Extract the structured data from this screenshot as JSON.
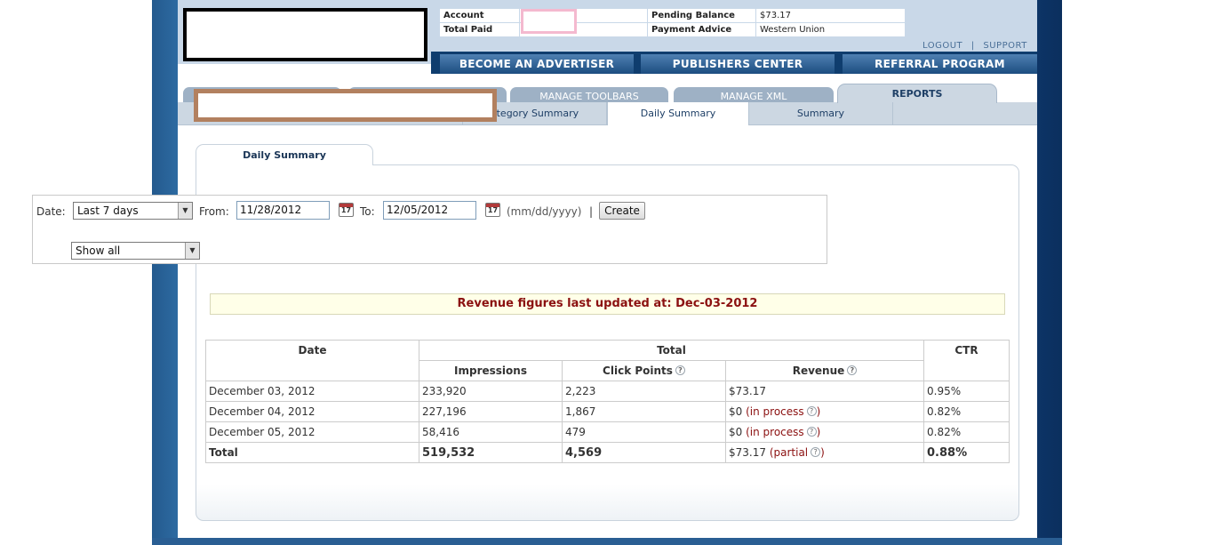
{
  "header": {
    "info": {
      "account_label": "Account",
      "total_paid_label": "Total Paid",
      "pending_balance_label": "Pending Balance",
      "pending_balance_value": "$73.17",
      "payment_advice_label": "Payment Advice",
      "payment_advice_value": "Western Union"
    },
    "links": {
      "logout": "LOGOUT",
      "support": "SUPPORT",
      "separator": "|"
    },
    "nav": [
      "BECOME AN ADVERTISER",
      "PUBLISHERS CENTER",
      "REFERRAL PROGRAM"
    ]
  },
  "tabs": {
    "top": [
      "MANAGE TOOLBARS",
      "MANAGE XML",
      "REPORTS"
    ],
    "sub": [
      "ategory Summary",
      "Daily Summary",
      "Summary"
    ]
  },
  "panel": {
    "title": "Daily Summary",
    "filters": {
      "date_label": "Date:",
      "date_select": "Last 7 days",
      "from_label": "From:",
      "from_value": "11/28/2012",
      "to_label": "To:",
      "to_value": "12/05/2012",
      "format_hint": "(mm/dd/yyyy)",
      "separator": "|",
      "create_button": "Create",
      "show_select": "Show all",
      "calendar_digit": "17"
    },
    "notice": "Revenue figures last updated at: Dec-03-2012"
  },
  "report": {
    "headers": {
      "date": "Date",
      "total": "Total",
      "ctr": "CTR",
      "impressions": "Impressions",
      "click_points": "Click Points",
      "revenue": "Revenue",
      "help_glyph": "?"
    },
    "rows": [
      {
        "date": "December 03, 2012",
        "impressions": "233,920",
        "clicks": "2,223",
        "revenue": "$73.17",
        "status": "",
        "ctr": "0.95%"
      },
      {
        "date": "December 04, 2012",
        "impressions": "227,196",
        "clicks": "1,867",
        "revenue": "$0",
        "status": "(in process",
        "ctr": "0.82%"
      },
      {
        "date": "December 05, 2012",
        "impressions": "58,416",
        "clicks": "479",
        "revenue": "$0",
        "status": "(in process",
        "ctr": "0.82%"
      }
    ],
    "total": {
      "label": "Total",
      "impressions": "519,532",
      "clicks": "4,569",
      "revenue": "$73.17",
      "status": "(partial",
      "ctr": "0.88%"
    },
    "close_paren": ")"
  }
}
